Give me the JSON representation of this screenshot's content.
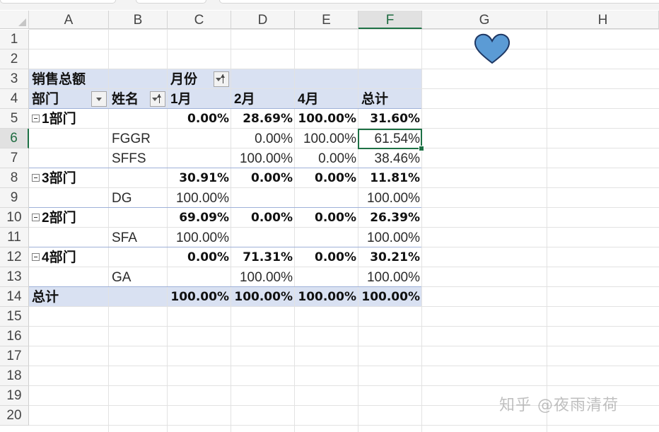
{
  "columns": [
    "A",
    "B",
    "C",
    "D",
    "E",
    "F",
    "G",
    "H"
  ],
  "rows": [
    "1",
    "2",
    "3",
    "4",
    "5",
    "6",
    "7",
    "8",
    "9",
    "10",
    "11",
    "12",
    "13",
    "14",
    "15",
    "16",
    "17",
    "18",
    "19",
    "20"
  ],
  "selected_cell": {
    "column": "F",
    "row": "6"
  },
  "pivot": {
    "value_field_label": "销售总额",
    "col_field_label": "月份",
    "row_field_label_1": "部门",
    "row_field_label_2": "姓名",
    "col_headers": [
      "1月",
      "2月",
      "4月",
      "总计"
    ],
    "groups": [
      {
        "dept": "1部门",
        "values": [
          "0.00%",
          "28.69%",
          "100.00%",
          "31.60%"
        ],
        "people": [
          {
            "name": "FGGR",
            "values": [
              "",
              "0.00%",
              "100.00%",
              "61.54%"
            ]
          },
          {
            "name": "SFFS",
            "values": [
              "",
              "100.00%",
              "0.00%",
              "38.46%"
            ]
          }
        ]
      },
      {
        "dept": "3部门",
        "values": [
          "30.91%",
          "0.00%",
          "0.00%",
          "11.81%"
        ],
        "people": [
          {
            "name": "DG",
            "values": [
              "100.00%",
              "",
              "",
              "100.00%"
            ]
          }
        ]
      },
      {
        "dept": "2部门",
        "values": [
          "69.09%",
          "0.00%",
          "0.00%",
          "26.39%"
        ],
        "people": [
          {
            "name": "SFA",
            "values": [
              "100.00%",
              "",
              "",
              "100.00%"
            ]
          }
        ]
      },
      {
        "dept": "4部门",
        "values": [
          "0.00%",
          "71.31%",
          "0.00%",
          "30.21%"
        ],
        "people": [
          {
            "name": "GA",
            "values": [
              "",
              "100.00%",
              "",
              "100.00%"
            ]
          }
        ]
      }
    ],
    "grand_total_label": "总计",
    "grand_total_values": [
      "100.00%",
      "100.00%",
      "100.00%",
      "100.00%"
    ]
  },
  "watermark": "知乎 @夜雨清荷",
  "colors": {
    "header_band": "#d9e1f2",
    "selection": "#1e7145",
    "heart_fill": "#5b9bd5",
    "heart_stroke": "#1f3864"
  },
  "heart_icon": "heart-shape"
}
